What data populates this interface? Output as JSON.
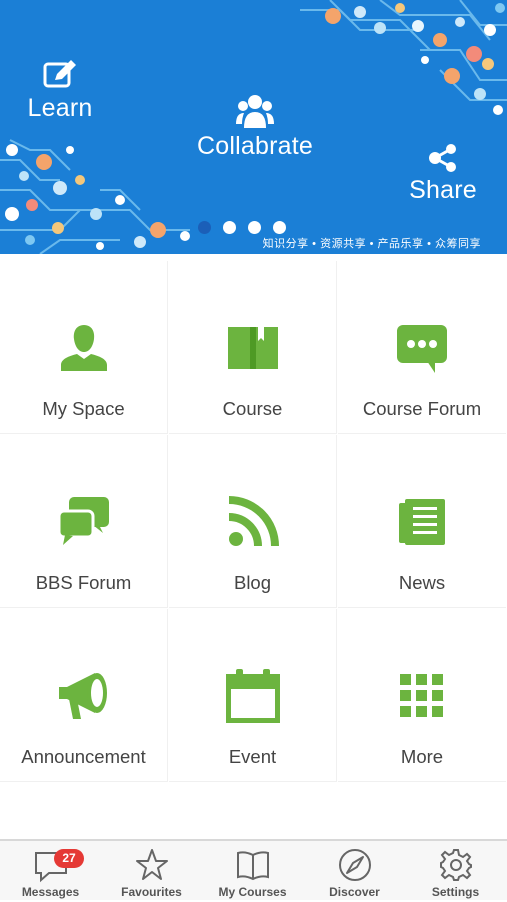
{
  "banner": {
    "highlights": [
      {
        "label": "Learn",
        "icon": "edit-icon"
      },
      {
        "label": "Collabrate",
        "icon": "group-icon"
      },
      {
        "label": "Share",
        "icon": "share-icon"
      }
    ],
    "tagline": "知识分享 • 资源共享 • 产品乐享 • 众筹同享",
    "carousel": {
      "slide_count": 4,
      "active_index": 0
    }
  },
  "grid": [
    {
      "label": "My Space",
      "icon": "user-icon"
    },
    {
      "label": "Course",
      "icon": "book-icon"
    },
    {
      "label": "Course Forum",
      "icon": "chat-bubble-icon"
    },
    {
      "label": "BBS Forum",
      "icon": "chat-bubbles-icon"
    },
    {
      "label": "Blog",
      "icon": "rss-icon"
    },
    {
      "label": "News",
      "icon": "newspaper-icon"
    },
    {
      "label": "Announcement",
      "icon": "megaphone-icon"
    },
    {
      "label": "Event",
      "icon": "calendar-icon"
    },
    {
      "label": "More",
      "icon": "grid-icon"
    }
  ],
  "tabbar": {
    "items": [
      {
        "label": "Messages",
        "icon": "message-icon",
        "badge": "27"
      },
      {
        "label": "Favourites",
        "icon": "star-icon"
      },
      {
        "label": "My Courses",
        "icon": "open-book-icon"
      },
      {
        "label": "Discover",
        "icon": "compass-icon"
      },
      {
        "label": "Settings",
        "icon": "gear-icon"
      }
    ]
  },
  "colors": {
    "banner": "#1b7fd6",
    "accent": "#6cb43f",
    "badge": "#e53935",
    "text": "#444444"
  }
}
